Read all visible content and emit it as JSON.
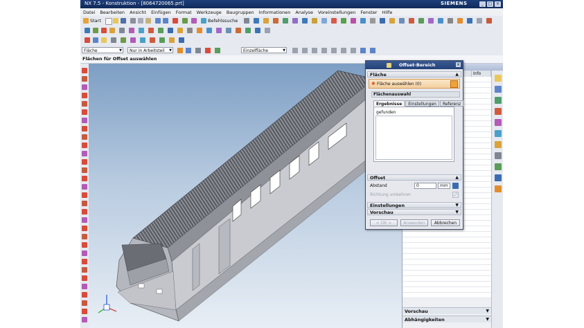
{
  "window": {
    "title": "NX 7.5 - Konstruktion - [8064720065.prt]",
    "brand": "SIEMENS"
  },
  "menu": [
    "Datei",
    "Bearbeiten",
    "Ansicht",
    "Einfügen",
    "Format",
    "Werkzeuge",
    "Baugruppen",
    "Informationen",
    "Analyse",
    "Voreinstellungen",
    "Fenster",
    "Hilfe"
  ],
  "toolbar": {
    "start_label": "Start",
    "befehlssuche_label": "Befehlssuche"
  },
  "selection_bar": {
    "type_filter": "Fläche",
    "scope_filter": "Nur in Arbeitsteil",
    "face_rule": "Einzelfläche"
  },
  "cue_line": "Flächen für Offset auswählen",
  "navigator": {
    "column_info": "Info",
    "bottom_sections": [
      "Vorschau",
      "Abhängigkeiten"
    ]
  },
  "dialog": {
    "title": "Offset-Bereich",
    "section_flaeche": "Fläche",
    "select_faces_label": "Fläche auswählen (0)",
    "flaechenauswahl": "Flächenauswahl",
    "tabs": [
      "Ergebnisse",
      "Einstellungen",
      "Referenz"
    ],
    "gefunden": "gefunden",
    "section_offset": "Offset",
    "abstand_label": "Abstand",
    "abstand_value": "0",
    "abstand_unit": "mm",
    "richtung_label": "Richtung umkehren",
    "section_einstellungen": "Einstellungen",
    "section_vorschau": "Vorschau",
    "btn_ok": "< OK >",
    "btn_anwenden": "Anwenden",
    "btn_abbrechen": "Abbrechen"
  },
  "colors": {
    "title_bar": "#1e3f7a",
    "highlight_row": "#f2cfa0",
    "viewport_top": "#7d9ec4",
    "viewport_bottom": "#e8eef5",
    "model_gray": "#c9cbd0"
  },
  "icons": [
    "start-icon",
    "new-file-icon",
    "open-icon",
    "save-icon",
    "undo-icon",
    "redo-icon",
    "search-icon",
    "triad-icon",
    "face-select-icon",
    "close-icon",
    "chevron-down-icon"
  ]
}
